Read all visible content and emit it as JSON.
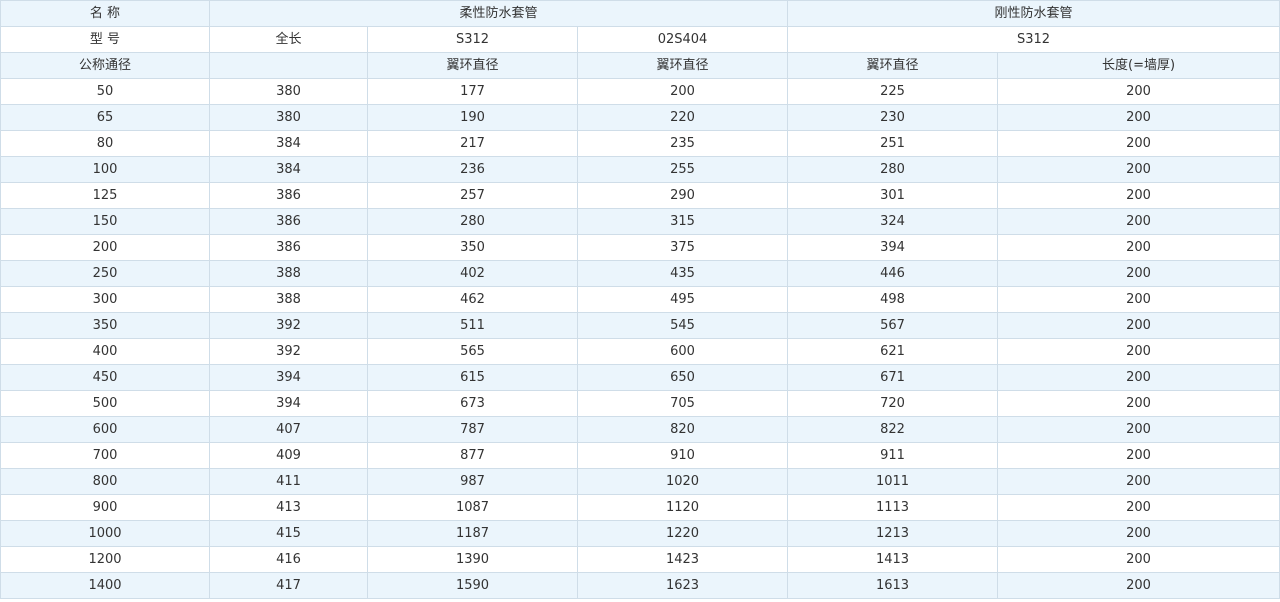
{
  "table": {
    "header_row_1": {
      "name_label": "名 称",
      "flexible_label": "柔性防水套管",
      "rigid_label": "刚性防水套管"
    },
    "header_row_2": {
      "model_label": "型 号",
      "total_length_label": "全长",
      "flexible_std_1": "S312",
      "flexible_std_2": "02S404",
      "rigid_std": "S312"
    },
    "header_row_3": {
      "nominal_diameter_label": "公称通径",
      "blank": "",
      "flange_diameter_1": "翼环直径",
      "flange_diameter_2": "翼环直径",
      "flange_diameter_3": "翼环直径",
      "length_label": "长度(=墙厚)"
    },
    "rows": [
      [
        "50",
        "380",
        "177",
        "200",
        "225",
        "200"
      ],
      [
        "65",
        "380",
        "190",
        "220",
        "230",
        "200"
      ],
      [
        "80",
        "384",
        "217",
        "235",
        "251",
        "200"
      ],
      [
        "100",
        "384",
        "236",
        "255",
        "280",
        "200"
      ],
      [
        "125",
        "386",
        "257",
        "290",
        "301",
        "200"
      ],
      [
        "150",
        "386",
        "280",
        "315",
        "324",
        "200"
      ],
      [
        "200",
        "386",
        "350",
        "375",
        "394",
        "200"
      ],
      [
        "250",
        "388",
        "402",
        "435",
        "446",
        "200"
      ],
      [
        "300",
        "388",
        "462",
        "495",
        "498",
        "200"
      ],
      [
        "350",
        "392",
        "511",
        "545",
        "567",
        "200"
      ],
      [
        "400",
        "392",
        "565",
        "600",
        "621",
        "200"
      ],
      [
        "450",
        "394",
        "615",
        "650",
        "671",
        "200"
      ],
      [
        "500",
        "394",
        "673",
        "705",
        "720",
        "200"
      ],
      [
        "600",
        "407",
        "787",
        "820",
        "822",
        "200"
      ],
      [
        "700",
        "409",
        "877",
        "910",
        "911",
        "200"
      ],
      [
        "800",
        "411",
        "987",
        "1020",
        "1011",
        "200"
      ],
      [
        "900",
        "413",
        "1087",
        "1120",
        "1113",
        "200"
      ],
      [
        "1000",
        "415",
        "1187",
        "1220",
        "1213",
        "200"
      ],
      [
        "1200",
        "416",
        "1390",
        "1423",
        "1413",
        "200"
      ],
      [
        "1400",
        "417",
        "1590",
        "1623",
        "1613",
        "200"
      ]
    ]
  }
}
